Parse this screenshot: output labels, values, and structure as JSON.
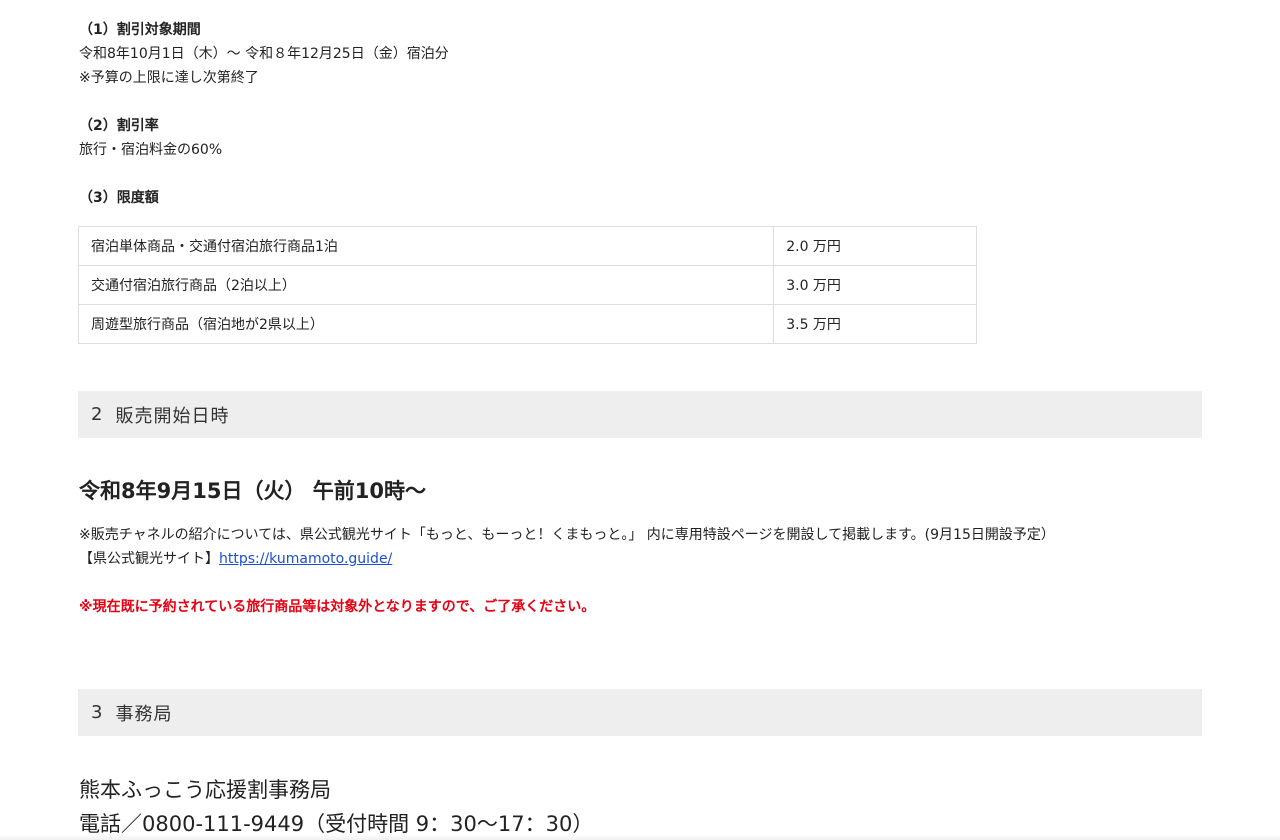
{
  "section1": {
    "period_heading": "（1）割引対象期間",
    "period_text": "令和8年10月1日（木）〜 令和８年12月25日（金）宿泊分",
    "period_note": "※予算の上限に達し次第終了",
    "rate_heading": "（2）割引率",
    "rate_text": "旅行・宿泊料金の60%",
    "limit_heading": "（3）限度額",
    "limits": [
      {
        "item": "宿泊単体商品・交通付宿泊旅行商品1泊",
        "amount": "2.0 万円"
      },
      {
        "item": "交通付宿泊旅行商品（2泊以上）",
        "amount": "3.0 万円"
      },
      {
        "item": "周遊型旅行商品（宿泊地が2県以上）",
        "amount": "3.5 万円"
      }
    ]
  },
  "section2": {
    "number": "2",
    "title": "販売開始日時",
    "date_text": "令和8年9月15日（火） 午前10時〜",
    "channel_note": "※販売チャネルの紹介については、県公式観光サイト「もっと、もーっと！くまもっと。」 内に専用特設ページを開設して掲載します。(9月15日開設予定）",
    "site_label": "【県公式観光サイト】",
    "site_link": "https://kumamoto.guide/",
    "warning": "※現在既に予約されている旅行商品等は対象外となりますので、ご了承ください。"
  },
  "section3": {
    "number": "3",
    "title": "事務局",
    "office_name": "熊本ふっこう応援割事務局",
    "office_tel": "電話／0800-111-9449（受付時間 9：30〜17：30）"
  },
  "colors": {
    "band_bg": "#eeeeee",
    "link": "#1a4fd6",
    "warning": "#e60012",
    "text": "#222222"
  }
}
